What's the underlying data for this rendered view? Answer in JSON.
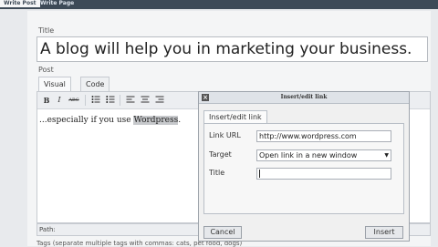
{
  "topbar": {
    "tabs": [
      {
        "label": "Write Post",
        "active": true
      },
      {
        "label": "Write Page",
        "active": false
      }
    ]
  },
  "labels": {
    "title": "Title",
    "post": "Post",
    "path": "Path:",
    "tags": "Tags (separate multiple tags with commas: cats, pet food, dogs)"
  },
  "post_title": "A blog will help you in marketing your business.",
  "editor": {
    "tabs": [
      {
        "label": "Visual",
        "active": true
      },
      {
        "label": "Code",
        "active": false
      }
    ],
    "toolbar_buttons": [
      "B",
      "I",
      "ABC"
    ],
    "content_before": "...especially if you use ",
    "content_highlight": "Wordpress",
    "content_after": "."
  },
  "dialog": {
    "title": "Insert/edit link",
    "close_icon": "close-icon",
    "tab_label": "Insert/edit link",
    "fields": {
      "link_url_label": "Link URL",
      "link_url_value": "http://www.wordpress.com",
      "target_label": "Target",
      "target_value": "Open link in a new window",
      "title_label": "Title",
      "title_value": ""
    },
    "cancel_label": "Cancel",
    "insert_label": "Insert"
  }
}
